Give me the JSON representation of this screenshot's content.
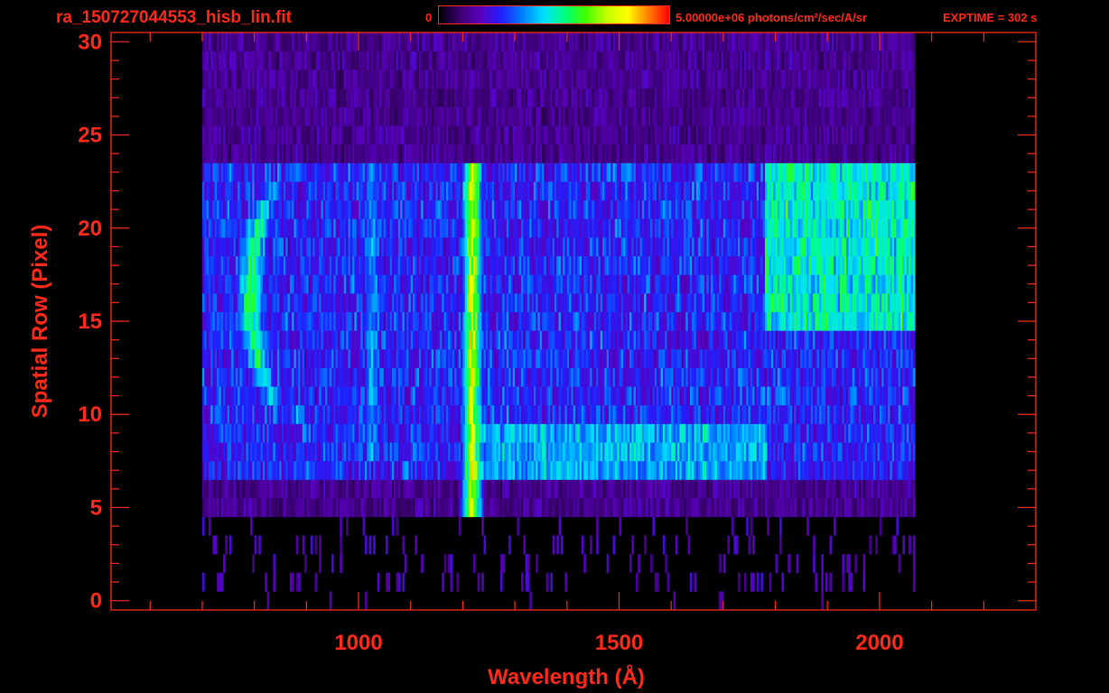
{
  "header": {
    "filename": "ra_150727044553_hisb_lin.fit",
    "colorbar_min": "0",
    "colorbar_max_label": "5.00000e+06 photons/cm²/sec/A/sr",
    "exptime": "EXPTIME = 302 s"
  },
  "colors": {
    "accent": "#ff2a1a",
    "background": "#000000",
    "colormap": [
      "#000000",
      "#3a0070",
      "#5a00c0",
      "#2020ff",
      "#0080ff",
      "#00e0ff",
      "#00ff80",
      "#40ff00",
      "#c0ff00",
      "#ffff00",
      "#ff8000",
      "#ff0000"
    ]
  },
  "chart_data": {
    "type": "heatmap",
    "title": "ra_150727044553_hisb_lin.fit",
    "xlabel": "Wavelength (Å)",
    "ylabel": "Spatial Row (Pixel)",
    "xlim": [
      525,
      2300
    ],
    "ylim": [
      -0.5,
      30.5
    ],
    "x_ticks": [
      1000,
      1500,
      2000
    ],
    "y_ticks": [
      0,
      5,
      10,
      15,
      20,
      25,
      30
    ],
    "colorbar_range": [
      0,
      5000000
    ],
    "colorbar_units": "photons/cm²/sec/A/sr",
    "exptime_s": 302,
    "data_extent_wavelength": [
      700,
      2065
    ],
    "features": [
      {
        "kind": "emission line",
        "wavelength": 1216,
        "rows": [
          5,
          23
        ],
        "level": 0.85
      },
      {
        "kind": "emission line",
        "wavelength": 1025,
        "rows": [
          8,
          23
        ],
        "level": 0.45
      },
      {
        "kind": "arc",
        "wavelength_range": [
          785,
          880
        ],
        "rows": [
          10,
          23
        ],
        "level": 0.75
      },
      {
        "kind": "band",
        "wavelength_range": [
          1220,
          1780
        ],
        "rows": [
          7,
          9
        ],
        "level": 0.5
      },
      {
        "kind": "band",
        "wavelength_range": [
          1780,
          2065
        ],
        "rows": [
          15,
          23
        ],
        "level": 0.6
      }
    ]
  }
}
